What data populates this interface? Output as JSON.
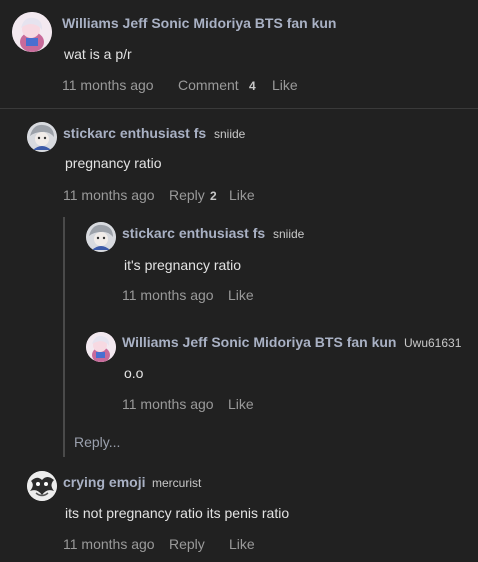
{
  "comments": [
    {
      "name": "Williams Jeff Sonic Midoriya BTS fan kun",
      "text": "wat is a p/r",
      "time": "11 months ago",
      "action_label": "Comment",
      "action_count": "4",
      "like_label": "Like"
    },
    {
      "name": "stickarc enthusiast fs",
      "handle": "sniide",
      "text": "pregnancy ratio",
      "time": "11 months ago",
      "action_label": "Reply",
      "action_count": "2",
      "like_label": "Like"
    },
    {
      "name": "stickarc enthusiast fs",
      "handle": "sniide",
      "text": "it's pregnancy ratio",
      "time": "11 months ago",
      "like_label": "Like"
    },
    {
      "name": "Williams Jeff Sonic Midoriya BTS fan kun",
      "handle": "Uwu61631",
      "text": "o.o",
      "time": "11 months ago",
      "like_label": "Like"
    },
    {
      "name": "crying emoji",
      "handle": "mercurist",
      "text": "its not pregnancy ratio its penis ratio",
      "time": "11 months ago",
      "action_label": "Reply",
      "like_label": "Like"
    }
  ],
  "reply_more_label": "Reply...",
  "colors": {
    "background": "#212121",
    "name": "#a9b1c4",
    "muted": "#9a9a9a"
  }
}
